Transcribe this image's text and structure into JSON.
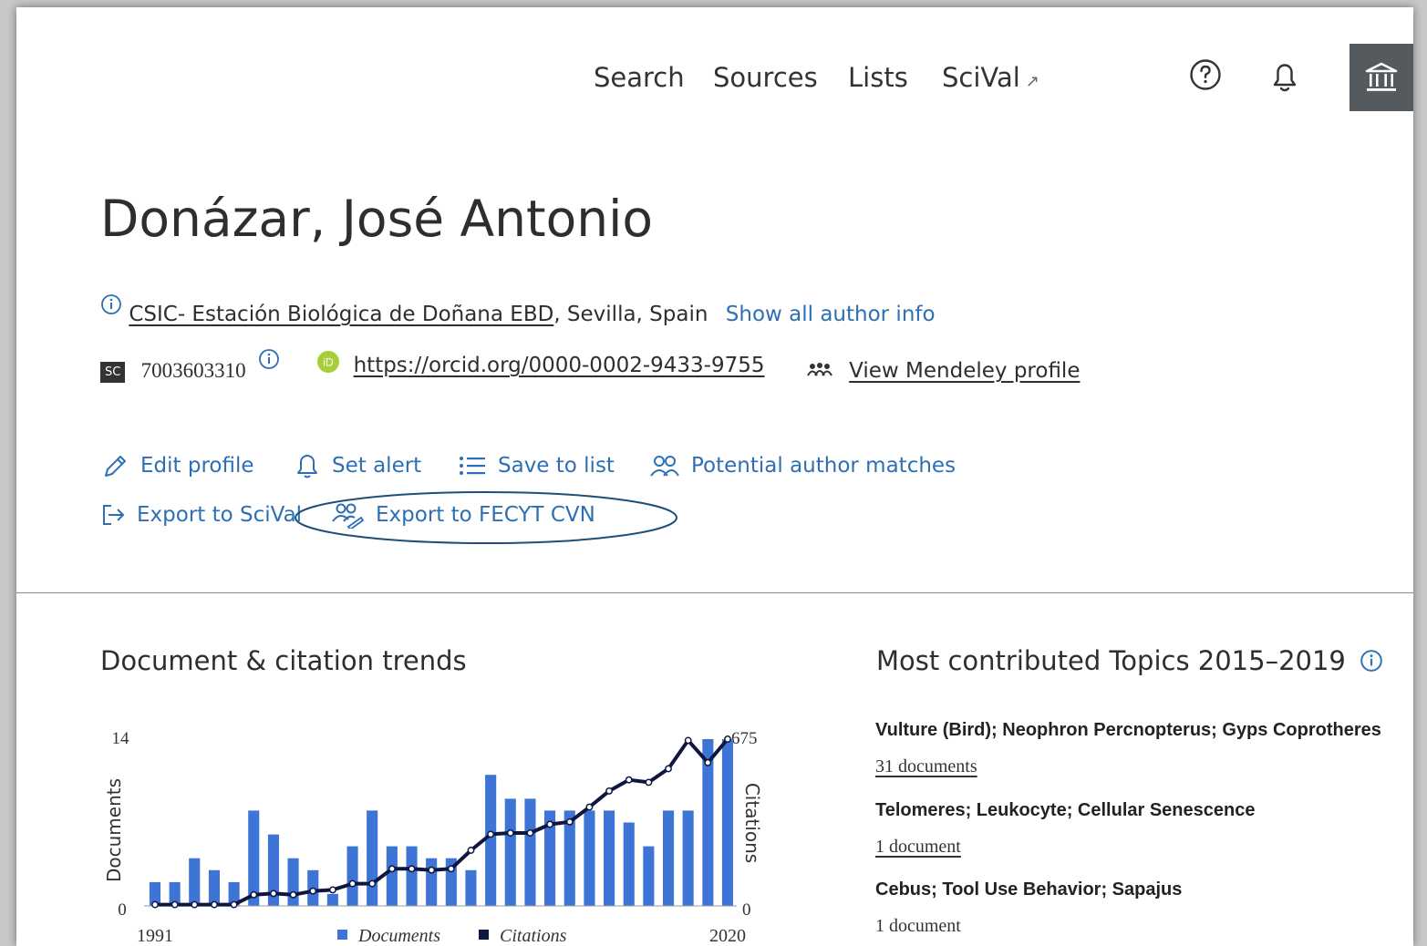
{
  "nav": {
    "items": [
      "Search",
      "Sources",
      "Lists",
      "SciVal"
    ],
    "scival_arrow": "↗"
  },
  "author": {
    "name": "Donázar, José Antonio",
    "affiliation_link": "CSIC- Estación Biológica de Doñana EBD",
    "affiliation_rest": ", Sevilla, Spain",
    "show_all": "Show all author info",
    "sc_badge": "SC",
    "scopus_id": "7003603310",
    "orcid_url": "https://orcid.org/0000-0002-9433-9755",
    "mendeley": "View Mendeley profile"
  },
  "actions": {
    "edit": "Edit profile",
    "alert": "Set alert",
    "save": "Save to list",
    "matches": "Potential author matches",
    "export_scival": "Export to SciVal",
    "export_fecyt": "Export to FECYT CVN"
  },
  "trends": {
    "title": "Document & citation trends"
  },
  "topics": {
    "title": "Most contributed Topics 2015–2019",
    "items": [
      {
        "title": "Vulture (Bird); Neophron Percnopterus; Gyps Coprotheres",
        "docs": "31 documents"
      },
      {
        "title": "Telomeres; Leukocyte; Cellular Senescence",
        "docs": "1 document"
      },
      {
        "title": "Cebus; Tool Use Behavior; Sapajus",
        "docs": "1 document"
      }
    ]
  },
  "colors": {
    "link": "#2e6fb4",
    "bars": "#3d74d6",
    "line": "#0f1740",
    "inst_box": "#545a5e"
  },
  "chart_data": {
    "type": "bar",
    "x": [
      1991,
      1992,
      1993,
      1994,
      1995,
      1996,
      1997,
      1998,
      1999,
      2000,
      2001,
      2002,
      2003,
      2004,
      2005,
      2006,
      2007,
      2008,
      2009,
      2010,
      2011,
      2012,
      2013,
      2014,
      2015,
      2016,
      2017,
      2018,
      2019,
      2020
    ],
    "x_tick_labels": [
      "1991",
      "2020"
    ],
    "series": [
      {
        "name": "Documents",
        "axis": "left",
        "type": "bar",
        "values": [
          2,
          2,
          4,
          3,
          2,
          8,
          6,
          4,
          3,
          1,
          5,
          8,
          5,
          5,
          4,
          4,
          3,
          11,
          9,
          9,
          8,
          8,
          8,
          8,
          7,
          5,
          8,
          8,
          14,
          14
        ]
      },
      {
        "name": "Citations",
        "axis": "right",
        "type": "line",
        "values": [
          5,
          5,
          5,
          5,
          5,
          45,
          50,
          45,
          60,
          65,
          90,
          90,
          150,
          150,
          145,
          150,
          225,
          290,
          295,
          295,
          330,
          340,
          400,
          465,
          510,
          500,
          555,
          670,
          580,
          675
        ]
      }
    ],
    "y_left": {
      "label": "Documents",
      "min": 0,
      "max": 14,
      "ticks": [
        0,
        14
      ]
    },
    "y_right": {
      "label": "Citations",
      "min": 0,
      "max": 675,
      "ticks": [
        0,
        675
      ]
    },
    "legend": {
      "position": "bottom"
    }
  }
}
